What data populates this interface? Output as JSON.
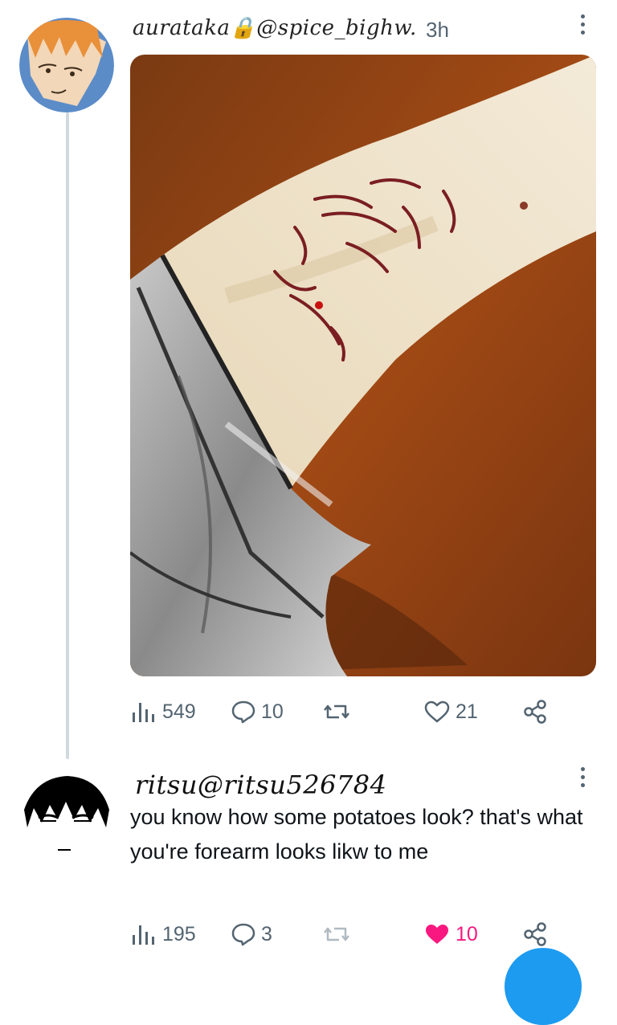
{
  "colors": {
    "accent": "#1d9bf0",
    "like": "#f91880",
    "muted": "#536471"
  },
  "post": {
    "author_handwritten": "aurataka🔒@spice_bighw.",
    "timestamp": "3h",
    "media_alt_icon": "artwork-image",
    "stats": {
      "views": "549",
      "replies": "10",
      "reposts": "",
      "likes": "21"
    }
  },
  "reply": {
    "author_handwritten": "ritsu@ritsu526784",
    "text": "you know how some potatoes look? that's what you're forearm looks likw to me",
    "stats": {
      "views": "195",
      "replies": "3",
      "reposts": "",
      "likes": "10",
      "liked": true
    }
  }
}
